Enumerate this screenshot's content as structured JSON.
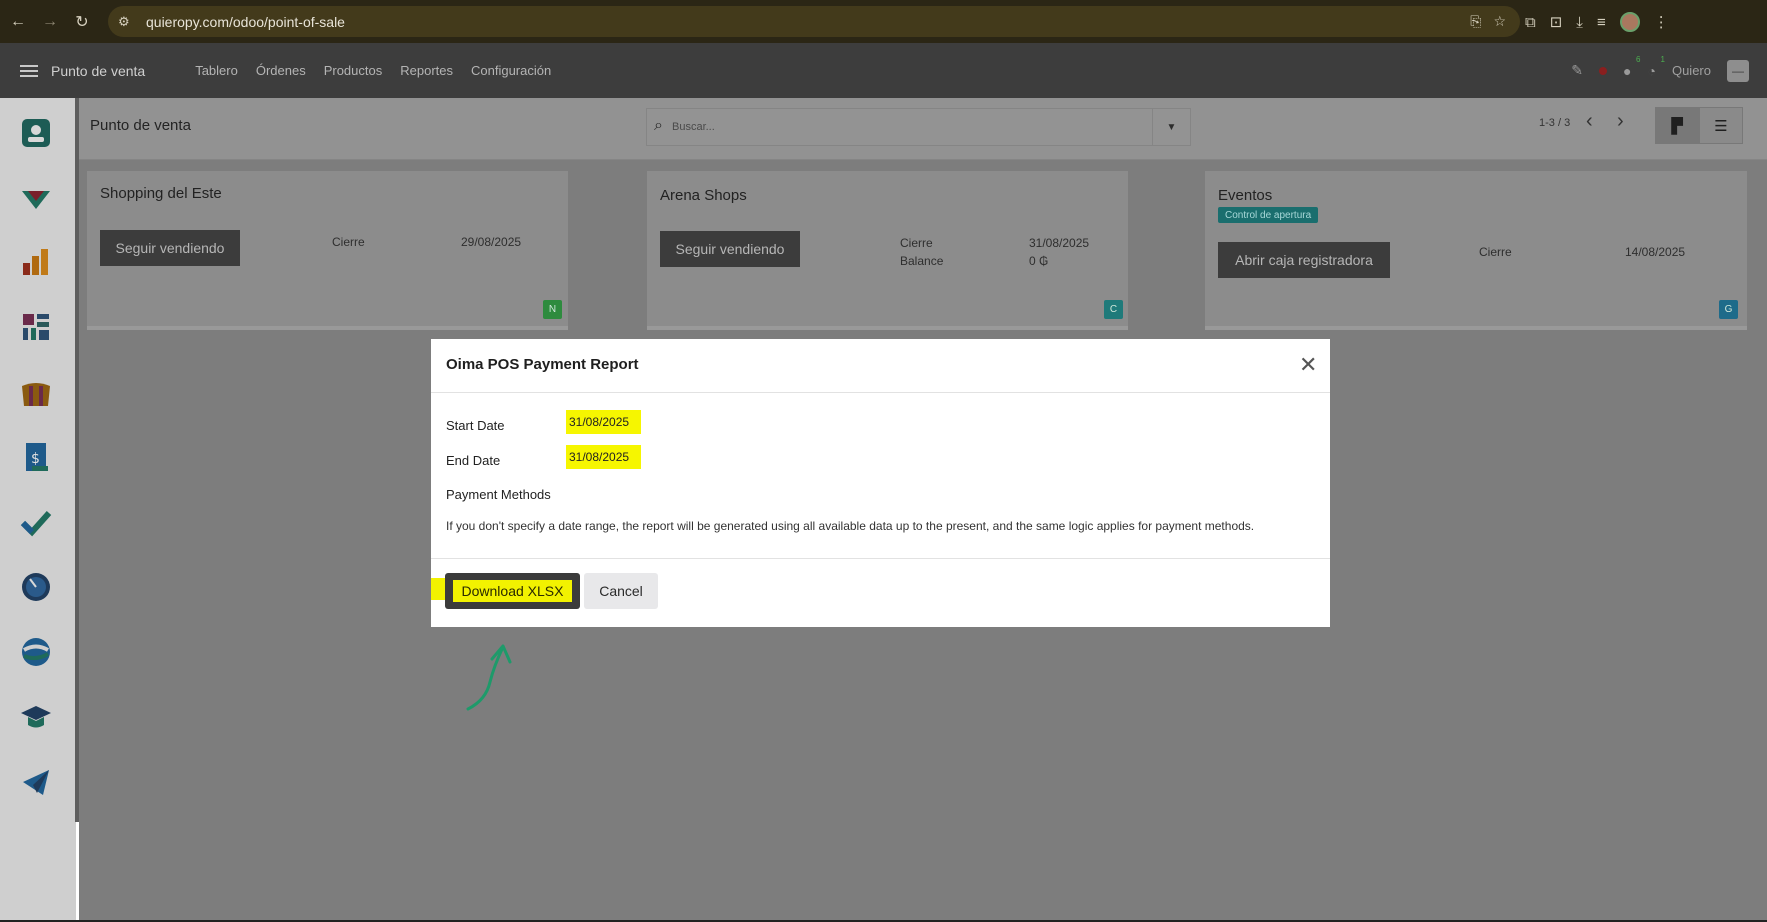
{
  "browser": {
    "url": "quieropy.com/odoo/point-of-sale"
  },
  "navbar": {
    "app_name": "Punto de venta",
    "menu": [
      "Tablero",
      "Órdenes",
      "Productos",
      "Reportes",
      "Configuración"
    ],
    "messages_count": "6",
    "activities_count": "1",
    "user_name": "Quiero"
  },
  "control_panel": {
    "breadcrumb": "Punto de venta",
    "search_placeholder": "Buscar...",
    "pager": "1-3 / 3"
  },
  "cards": [
    {
      "title": "Shopping del Este",
      "button": "Seguir vendiendo",
      "label1": "Cierre",
      "value1": "29/08/2025",
      "letter": "N",
      "letter_color": "#2e8b3e"
    },
    {
      "title": "Arena Shops",
      "button": "Seguir vendiendo",
      "label1": "Cierre",
      "value1": "31/08/2025",
      "label2": "Balance",
      "value2": "0 ₲",
      "letter": "C",
      "letter_color": "#1f7a7a"
    },
    {
      "title": "Eventos",
      "tag": "Control de apertura",
      "button": "Abrir caja registradora",
      "label1": "Cierre",
      "value1": "14/08/2025",
      "letter": "G",
      "letter_color": "#1e6b8a"
    }
  ],
  "dialog": {
    "title": "Oima POS Payment Report",
    "start_date_label": "Start Date",
    "start_date_value": "31/08/2025",
    "end_date_label": "End Date",
    "end_date_value": "31/08/2025",
    "payment_methods_label": "Payment Methods",
    "note": "If you don't specify a date range, the report will be generated using all available data up to the present, and the same logic applies for payment methods.",
    "download_label": "Download XLSX",
    "cancel_label": "Cancel"
  },
  "colors": {
    "highlight": "#f6f600",
    "annotation_arrow": "#1e9a6a"
  }
}
